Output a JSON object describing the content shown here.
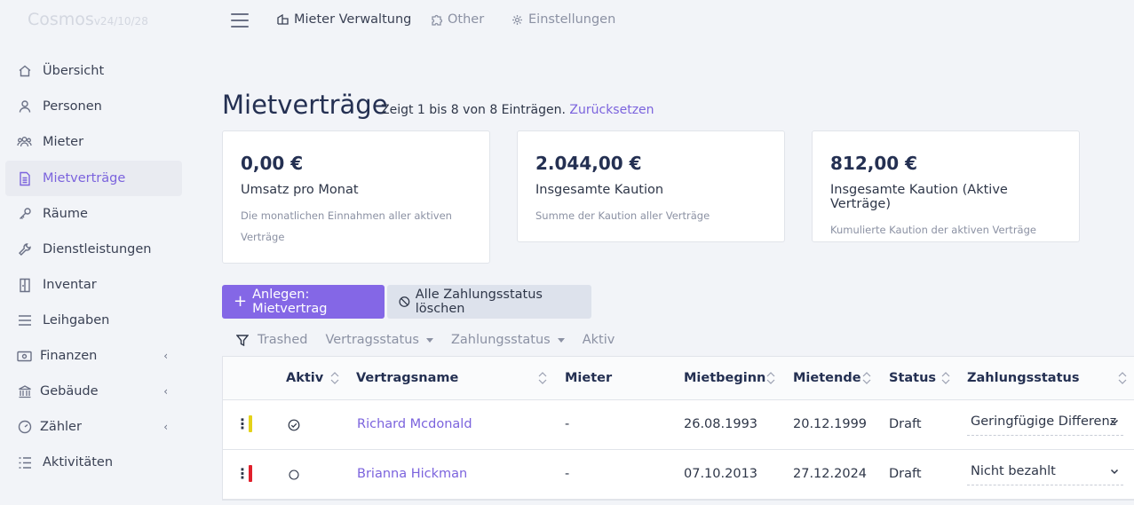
{
  "app": {
    "name": "Cosmos",
    "version": "v24/10/28"
  },
  "sidebar": {
    "items": [
      {
        "label": "Übersicht",
        "icon": "home-icon",
        "active": false
      },
      {
        "label": "Personen",
        "icon": "person-icon",
        "active": false
      },
      {
        "label": "Mieter",
        "icon": "users-icon",
        "active": false
      },
      {
        "label": "Mietverträge",
        "icon": "document-icon",
        "active": true
      },
      {
        "label": "Räume",
        "icon": "key-icon",
        "active": false
      },
      {
        "label": "Dienstleistungen",
        "icon": "wrench-icon",
        "active": false
      },
      {
        "label": "Inventar",
        "icon": "cabinet-icon",
        "active": false
      },
      {
        "label": "Leihgaben",
        "icon": "list-icon",
        "active": false
      },
      {
        "label": "Finanzen",
        "icon": "money-icon",
        "active": false,
        "expandable": true
      },
      {
        "label": "Gebäude",
        "icon": "bank-icon",
        "active": false,
        "expandable": true
      },
      {
        "label": "Zähler",
        "icon": "gauge-icon",
        "active": false,
        "expandable": true
      },
      {
        "label": "Aktivitäten",
        "icon": "activity-list-icon",
        "active": false
      }
    ]
  },
  "topnav": {
    "items": [
      {
        "label": "Mieter Verwaltung",
        "icon": "building-icon"
      },
      {
        "label": "Other",
        "icon": "puzzle-icon"
      },
      {
        "label": "Einstellungen",
        "icon": "gear-icon"
      }
    ]
  },
  "page": {
    "title": "Mietverträge",
    "subtitle": "Zeigt 1 bis 8 von 8 Einträgen.",
    "reset_label": "Zurücksetzen"
  },
  "stats": [
    {
      "value": "0,00 €",
      "title": "Umsatz pro Monat",
      "desc": "Die monatlichen Einnahmen aller aktiven Verträge"
    },
    {
      "value": "2.044,00 €",
      "title": "Insgesamte Kaution",
      "desc": "Summe der Kaution aller Verträge"
    },
    {
      "value": "812,00 €",
      "title": "Insgesamte Kaution (Aktive Verträge)",
      "desc": "Kumulierte Kaution der aktiven Verträge"
    }
  ],
  "actions": {
    "create_label": "Anlegen: Mietvertrag",
    "clear_label": "Alle Zahlungsstatus löschen"
  },
  "filters": {
    "trashed": "Trashed",
    "contract_status": "Vertragsstatus",
    "payment_status": "Zahlungsstatus",
    "active": "Aktiv"
  },
  "table": {
    "columns": {
      "aktiv": "Aktiv",
      "name": "Vertragsname",
      "tenant": "Mieter",
      "start": "Mietbeginn",
      "end": "Mietende",
      "status": "Status",
      "payment": "Zahlungsstatus"
    },
    "rows": [
      {
        "color": "#e4d21a",
        "active": true,
        "name": "Richard Mcdonald",
        "tenant": "-",
        "start": "26.08.1993",
        "end": "20.12.1999",
        "status": "Draft",
        "payment": "Geringfügige Differenz"
      },
      {
        "color": "#e0202c",
        "active": false,
        "name": "Brianna Hickman",
        "tenant": "-",
        "start": "07.10.2013",
        "end": "27.12.2024",
        "status": "Draft",
        "payment": "Nicht bezahlt"
      }
    ]
  },
  "colors": {
    "accent": "#8467e6",
    "link": "#7b63dd"
  }
}
